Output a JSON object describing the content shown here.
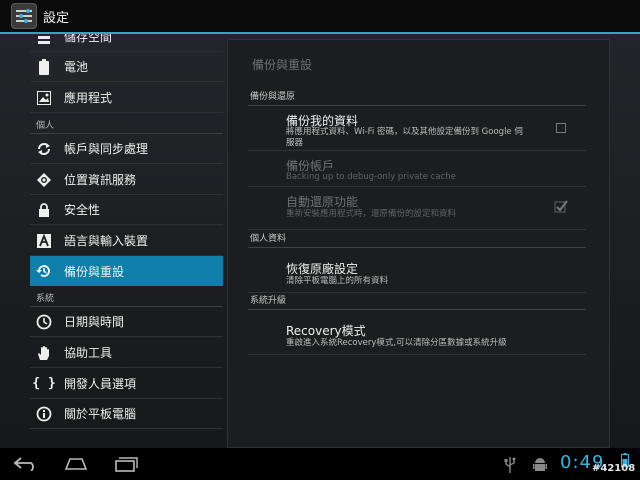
{
  "app": {
    "title": "設定",
    "accent": "#33b5e5",
    "active_bg": "#0e7fa9"
  },
  "sidebar": {
    "items": [
      {
        "label": "儲存空間",
        "icon": "storage-icon"
      },
      {
        "label": "電池",
        "icon": "battery-icon"
      },
      {
        "label": "應用程式",
        "icon": "apps-icon"
      },
      {
        "label": "帳戶與同步處理",
        "icon": "sync-icon"
      },
      {
        "label": "位置資訊服務",
        "icon": "location-icon"
      },
      {
        "label": "安全性",
        "icon": "lock-icon"
      },
      {
        "label": "語言與輸入裝置",
        "icon": "language-icon"
      },
      {
        "label": "備份與重設",
        "icon": "backup-icon",
        "active": true
      },
      {
        "label": "日期與時間",
        "icon": "clock-icon"
      },
      {
        "label": "協助工具",
        "icon": "hand-icon"
      },
      {
        "label": "開發人員選項",
        "icon": "braces-icon"
      },
      {
        "label": "關於平板電腦",
        "icon": "info-icon"
      }
    ],
    "headers": {
      "personal": "個人",
      "system": "系統"
    }
  },
  "panel": {
    "title": "備份與重設",
    "sections": {
      "backup": "備份與還原",
      "personal": "個人資料",
      "upgrade": "系統升級"
    },
    "items": {
      "backup_data": {
        "title": "備份我的資料",
        "summary": "將應用程式資料、Wi-Fi 密碼，以及其他設定備份到 Google 伺服器",
        "checked": false
      },
      "backup_account": {
        "title": "備份帳戶",
        "summary": "Backing up to debug-only private cache"
      },
      "auto_restore": {
        "title": "自動還原功能",
        "summary": "重新安裝應用程式時，還原備份的設定和資料",
        "checked": true
      },
      "factory_reset": {
        "title": "恢復原廠設定",
        "summary": "清除平板電腦上的所有資料"
      },
      "recovery": {
        "title": "Recovery模式",
        "summary": "重啟進入系統Recovery模式,可以清除分區數據或系統升級"
      }
    }
  },
  "navbar": {
    "clock": "0:49",
    "watermark": "#42108",
    "buttons": [
      "back-icon",
      "home-icon",
      "recent-apps-icon"
    ],
    "status_icons": [
      "usb-icon",
      "android-debug-icon",
      "battery-status-icon"
    ]
  }
}
